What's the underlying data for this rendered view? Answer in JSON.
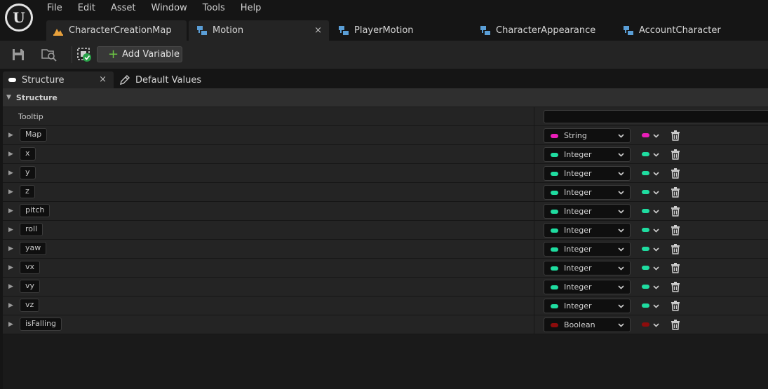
{
  "menu": [
    "File",
    "Edit",
    "Asset",
    "Window",
    "Tools",
    "Help"
  ],
  "tabs": [
    {
      "label": "CharacterCreationMap",
      "icon": "level-map-icon"
    },
    {
      "label": "Motion",
      "icon": "struct-icon",
      "close": "×"
    },
    {
      "label": "PlayerMotion",
      "icon": "struct-icon"
    },
    {
      "label": "CharacterAppearance",
      "icon": "struct-icon"
    },
    {
      "label": "AccountCharacter",
      "icon": "struct-icon"
    }
  ],
  "toolbar": {
    "add_variable_label": "Add Variable",
    "add_symbol": "+"
  },
  "panel_tabs": {
    "structure": "Structure",
    "structure_close": "×",
    "default_values": "Default Values"
  },
  "section": {
    "title": "Structure"
  },
  "tooltip": {
    "label": "Tooltip",
    "value": ""
  },
  "variables": [
    {
      "name": "Map",
      "type": "String",
      "color": "#e91eb8"
    },
    {
      "name": "x",
      "type": "Integer",
      "color": "#1fdca0"
    },
    {
      "name": "y",
      "type": "Integer",
      "color": "#1fdca0"
    },
    {
      "name": "z",
      "type": "Integer",
      "color": "#1fdca0"
    },
    {
      "name": "pitch",
      "type": "Integer",
      "color": "#1fdca0"
    },
    {
      "name": "roll",
      "type": "Integer",
      "color": "#1fdca0"
    },
    {
      "name": "yaw",
      "type": "Integer",
      "color": "#1fdca0"
    },
    {
      "name": "vx",
      "type": "Integer",
      "color": "#1fdca0"
    },
    {
      "name": "vy",
      "type": "Integer",
      "color": "#1fdca0"
    },
    {
      "name": "vz",
      "type": "Integer",
      "color": "#1fdca0"
    },
    {
      "name": "isFalling",
      "type": "Boolean",
      "color": "#8c0c0c"
    }
  ]
}
